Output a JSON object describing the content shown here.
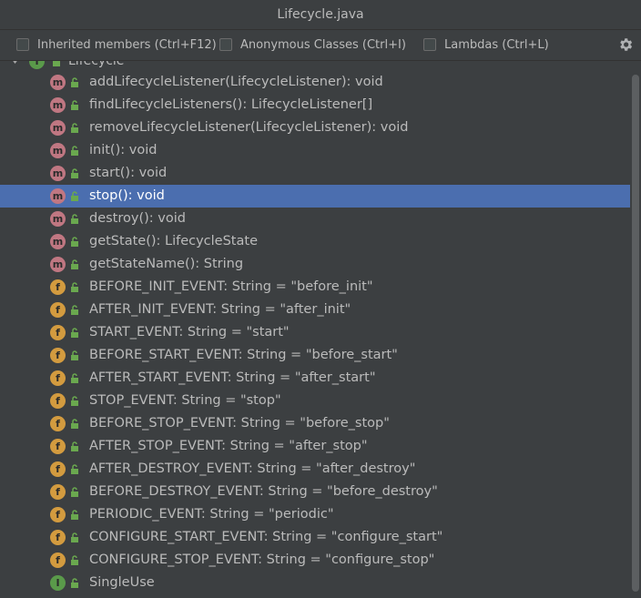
{
  "window": {
    "title": "Lifecycle.java"
  },
  "toolbar": {
    "inherited_label": "Inherited members (Ctrl+F12)",
    "anonymous_label": "Anonymous Classes (Ctrl+I)",
    "lambdas_label": "Lambdas (Ctrl+L)",
    "settings_icon": "gear-icon"
  },
  "root": {
    "label": "Lifecycle",
    "icon": "interface-icon"
  },
  "colors": {
    "background": "#3c3f41",
    "selection": "#4b6eaf",
    "method_icon": "#c07782",
    "field_icon": "#d39b3f",
    "interface_icon": "#5a9a4a",
    "lock": "#6aa84f"
  },
  "members": [
    {
      "kind": "m",
      "label": "addLifecycleListener(LifecycleListener): void",
      "selected": false
    },
    {
      "kind": "m",
      "label": "findLifecycleListeners(): LifecycleListener[]",
      "selected": false
    },
    {
      "kind": "m",
      "label": "removeLifecycleListener(LifecycleListener): void",
      "selected": false
    },
    {
      "kind": "m",
      "label": "init(): void",
      "selected": false
    },
    {
      "kind": "m",
      "label": "start(): void",
      "selected": false
    },
    {
      "kind": "m",
      "label": "stop(): void",
      "selected": true
    },
    {
      "kind": "m",
      "label": "destroy(): void",
      "selected": false
    },
    {
      "kind": "m",
      "label": "getState(): LifecycleState",
      "selected": false
    },
    {
      "kind": "m",
      "label": "getStateName(): String",
      "selected": false
    },
    {
      "kind": "f",
      "label": "BEFORE_INIT_EVENT: String = \"before_init\"",
      "selected": false
    },
    {
      "kind": "f",
      "label": "AFTER_INIT_EVENT: String = \"after_init\"",
      "selected": false
    },
    {
      "kind": "f",
      "label": "START_EVENT: String = \"start\"",
      "selected": false
    },
    {
      "kind": "f",
      "label": "BEFORE_START_EVENT: String = \"before_start\"",
      "selected": false
    },
    {
      "kind": "f",
      "label": "AFTER_START_EVENT: String = \"after_start\"",
      "selected": false
    },
    {
      "kind": "f",
      "label": "STOP_EVENT: String = \"stop\"",
      "selected": false
    },
    {
      "kind": "f",
      "label": "BEFORE_STOP_EVENT: String = \"before_stop\"",
      "selected": false
    },
    {
      "kind": "f",
      "label": "AFTER_STOP_EVENT: String = \"after_stop\"",
      "selected": false
    },
    {
      "kind": "f",
      "label": "AFTER_DESTROY_EVENT: String = \"after_destroy\"",
      "selected": false
    },
    {
      "kind": "f",
      "label": "BEFORE_DESTROY_EVENT: String = \"before_destroy\"",
      "selected": false
    },
    {
      "kind": "f",
      "label": "PERIODIC_EVENT: String = \"periodic\"",
      "selected": false
    },
    {
      "kind": "f",
      "label": "CONFIGURE_START_EVENT: String = \"configure_start\"",
      "selected": false
    },
    {
      "kind": "f",
      "label": "CONFIGURE_STOP_EVENT: String = \"configure_stop\"",
      "selected": false
    },
    {
      "kind": "i",
      "label": "SingleUse",
      "selected": false
    }
  ]
}
